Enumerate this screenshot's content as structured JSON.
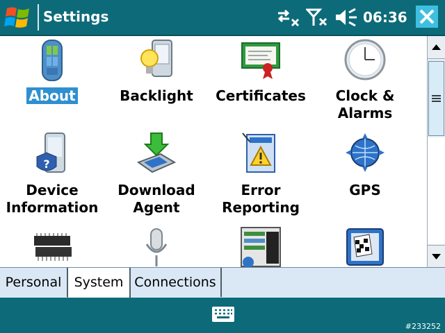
{
  "titlebar": {
    "title": "Settings",
    "time": "06:36",
    "icons": [
      "windows-start-icon",
      "connectivity-off-icon",
      "signal-off-icon",
      "volume-mute-icon",
      "close-icon"
    ]
  },
  "items": [
    {
      "id": "about",
      "label": "About",
      "icon": "about-device-icon",
      "selected": true
    },
    {
      "id": "backlight",
      "label": "Backlight",
      "icon": "backlight-bulb-icon"
    },
    {
      "id": "certificates",
      "label": "Certificates",
      "icon": "certificate-icon"
    },
    {
      "id": "clock",
      "label": "Clock &\nAlarms",
      "icon": "clock-icon"
    },
    {
      "id": "device-information",
      "label": "Device\nInformation",
      "icon": "device-info-icon"
    },
    {
      "id": "download-agent",
      "label": "Download\nAgent",
      "icon": "download-agent-icon"
    },
    {
      "id": "error-reporting",
      "label": "Error\nReporting",
      "icon": "error-reporting-icon"
    },
    {
      "id": "gps",
      "label": "GPS",
      "icon": "gps-globe-icon"
    },
    {
      "id": "memory",
      "label": "",
      "icon": "memory-chip-icon"
    },
    {
      "id": "microphone",
      "label": "",
      "icon": "microphone-icon"
    },
    {
      "id": "remove-programs",
      "label": "",
      "icon": "remove-programs-icon"
    },
    {
      "id": "screen",
      "label": "",
      "icon": "screen-flag-icon"
    }
  ],
  "tabs": [
    {
      "label": "Personal",
      "active": false
    },
    {
      "label": "System",
      "active": true
    },
    {
      "label": "Connections",
      "active": false
    }
  ],
  "bottombar": {
    "icon": "keyboard-icon",
    "corner_text": "#233252"
  },
  "colors": {
    "bar": "#0d6b79",
    "selection": "#2f8fd0",
    "tab_background": "#d9e8f4",
    "close_button": "#3fbfe0"
  }
}
